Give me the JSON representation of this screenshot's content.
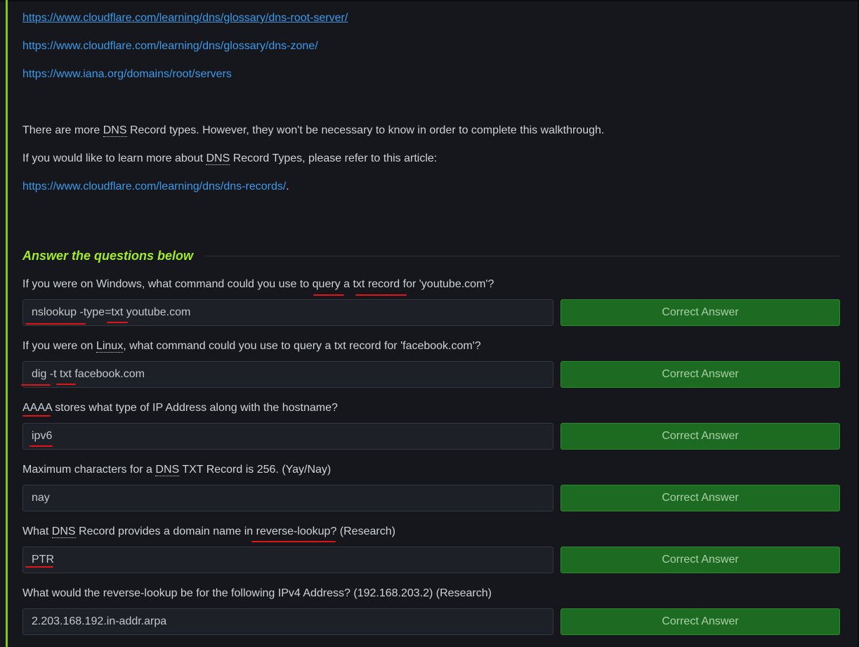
{
  "links": {
    "root_server": "https://www.cloudflare.com/learning/dns/glossary/dns-root-server/",
    "dns_zone": "https://www.cloudflare.com/learning/dns/glossary/dns-zone/",
    "iana": "https://www.iana.org/domains/root/servers",
    "dns_records": "https://www.cloudflare.com/learning/dns/dns-records/"
  },
  "paragraphs": {
    "more_types_pre": "There are more ",
    "dns": "DNS",
    "more_types_post": " Record types. However, they won't be necessary to know in order to complete this walkthrough.",
    "learn_more_pre": "If you would like to learn more about ",
    "learn_more_post": " Record Types, please refer to this article:",
    "period": "."
  },
  "section": {
    "heading": "Answer the questions below"
  },
  "questions": [
    {
      "text_parts": [
        "If you were on Windows, what command could you use to ",
        "query",
        " a ",
        "txt record",
        " for 'youtube.com'?"
      ],
      "answer": "nslookup -type=txt youtube.com",
      "status": "Correct Answer"
    },
    {
      "text_parts": [
        "If you were on ",
        "Linux",
        ", what command could you use to query a txt record for 'facebook.com'?"
      ],
      "answer": "dig -t txt facebook.com",
      "status": "Correct Answer"
    },
    {
      "text_parts": [
        "AAAA",
        " stores what type of IP Address along with the hostname?"
      ],
      "answer": "ipv6",
      "status": "Correct Answer"
    },
    {
      "text_parts": [
        "Maximum characters for a ",
        "DNS",
        " TXT Record is 256. (Yay/Nay)"
      ],
      "answer": "nay",
      "status": "Correct Answer"
    },
    {
      "text_parts": [
        "What ",
        "DNS",
        " Record provides a domain name in ",
        "reverse-lookup?",
        " (Research)"
      ],
      "answer": "PTR",
      "status": "Correct Answer"
    },
    {
      "text_parts": [
        "What would the reverse-lookup be for the following IPv4 Address? (192.168.203.2) (Research)"
      ],
      "answer": "2.203.168.192.in-addr.arpa",
      "status": "Correct Answer"
    }
  ],
  "colors": {
    "background": "#15171c",
    "accent_bar": "#7fc31c",
    "heading": "#a3ea2a",
    "link": "#3d9ae8",
    "correct_button": "#1d6b22",
    "annotation_underline": "#e01616"
  }
}
